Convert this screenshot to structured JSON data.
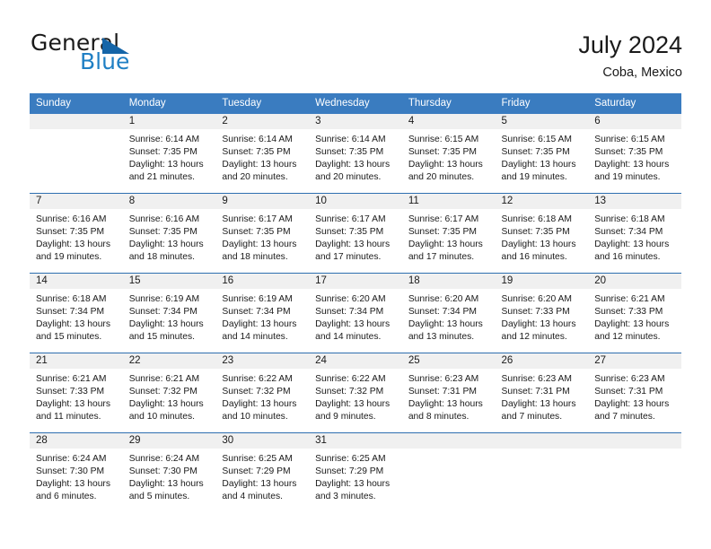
{
  "brand": {
    "word1": "General",
    "word2": "Blue",
    "flag_icon": "triangle-flag-icon"
  },
  "header": {
    "title": "July 2024",
    "subtitle": "Coba, Mexico"
  },
  "colors": {
    "header_blue": "#3a7cc0",
    "row_separator": "#2e6fb0",
    "daynum_band": "#f0f0f0",
    "brand_blue": "#1f7fc4",
    "flag_blue": "#1565a8",
    "text": "#1a1a1a"
  },
  "calendar": {
    "weekday_headers": [
      "Sunday",
      "Monday",
      "Tuesday",
      "Wednesday",
      "Thursday",
      "Friday",
      "Saturday"
    ],
    "weeks": [
      [
        {
          "day": "",
          "lines": []
        },
        {
          "day": "1",
          "lines": [
            "Sunrise: 6:14 AM",
            "Sunset: 7:35 PM",
            "Daylight: 13 hours",
            "and 21 minutes."
          ]
        },
        {
          "day": "2",
          "lines": [
            "Sunrise: 6:14 AM",
            "Sunset: 7:35 PM",
            "Daylight: 13 hours",
            "and 20 minutes."
          ]
        },
        {
          "day": "3",
          "lines": [
            "Sunrise: 6:14 AM",
            "Sunset: 7:35 PM",
            "Daylight: 13 hours",
            "and 20 minutes."
          ]
        },
        {
          "day": "4",
          "lines": [
            "Sunrise: 6:15 AM",
            "Sunset: 7:35 PM",
            "Daylight: 13 hours",
            "and 20 minutes."
          ]
        },
        {
          "day": "5",
          "lines": [
            "Sunrise: 6:15 AM",
            "Sunset: 7:35 PM",
            "Daylight: 13 hours",
            "and 19 minutes."
          ]
        },
        {
          "day": "6",
          "lines": [
            "Sunrise: 6:15 AM",
            "Sunset: 7:35 PM",
            "Daylight: 13 hours",
            "and 19 minutes."
          ]
        }
      ],
      [
        {
          "day": "7",
          "lines": [
            "Sunrise: 6:16 AM",
            "Sunset: 7:35 PM",
            "Daylight: 13 hours",
            "and 19 minutes."
          ]
        },
        {
          "day": "8",
          "lines": [
            "Sunrise: 6:16 AM",
            "Sunset: 7:35 PM",
            "Daylight: 13 hours",
            "and 18 minutes."
          ]
        },
        {
          "day": "9",
          "lines": [
            "Sunrise: 6:17 AM",
            "Sunset: 7:35 PM",
            "Daylight: 13 hours",
            "and 18 minutes."
          ]
        },
        {
          "day": "10",
          "lines": [
            "Sunrise: 6:17 AM",
            "Sunset: 7:35 PM",
            "Daylight: 13 hours",
            "and 17 minutes."
          ]
        },
        {
          "day": "11",
          "lines": [
            "Sunrise: 6:17 AM",
            "Sunset: 7:35 PM",
            "Daylight: 13 hours",
            "and 17 minutes."
          ]
        },
        {
          "day": "12",
          "lines": [
            "Sunrise: 6:18 AM",
            "Sunset: 7:35 PM",
            "Daylight: 13 hours",
            "and 16 minutes."
          ]
        },
        {
          "day": "13",
          "lines": [
            "Sunrise: 6:18 AM",
            "Sunset: 7:34 PM",
            "Daylight: 13 hours",
            "and 16 minutes."
          ]
        }
      ],
      [
        {
          "day": "14",
          "lines": [
            "Sunrise: 6:18 AM",
            "Sunset: 7:34 PM",
            "Daylight: 13 hours",
            "and 15 minutes."
          ]
        },
        {
          "day": "15",
          "lines": [
            "Sunrise: 6:19 AM",
            "Sunset: 7:34 PM",
            "Daylight: 13 hours",
            "and 15 minutes."
          ]
        },
        {
          "day": "16",
          "lines": [
            "Sunrise: 6:19 AM",
            "Sunset: 7:34 PM",
            "Daylight: 13 hours",
            "and 14 minutes."
          ]
        },
        {
          "day": "17",
          "lines": [
            "Sunrise: 6:20 AM",
            "Sunset: 7:34 PM",
            "Daylight: 13 hours",
            "and 14 minutes."
          ]
        },
        {
          "day": "18",
          "lines": [
            "Sunrise: 6:20 AM",
            "Sunset: 7:34 PM",
            "Daylight: 13 hours",
            "and 13 minutes."
          ]
        },
        {
          "day": "19",
          "lines": [
            "Sunrise: 6:20 AM",
            "Sunset: 7:33 PM",
            "Daylight: 13 hours",
            "and 12 minutes."
          ]
        },
        {
          "day": "20",
          "lines": [
            "Sunrise: 6:21 AM",
            "Sunset: 7:33 PM",
            "Daylight: 13 hours",
            "and 12 minutes."
          ]
        }
      ],
      [
        {
          "day": "21",
          "lines": [
            "Sunrise: 6:21 AM",
            "Sunset: 7:33 PM",
            "Daylight: 13 hours",
            "and 11 minutes."
          ]
        },
        {
          "day": "22",
          "lines": [
            "Sunrise: 6:21 AM",
            "Sunset: 7:32 PM",
            "Daylight: 13 hours",
            "and 10 minutes."
          ]
        },
        {
          "day": "23",
          "lines": [
            "Sunrise: 6:22 AM",
            "Sunset: 7:32 PM",
            "Daylight: 13 hours",
            "and 10 minutes."
          ]
        },
        {
          "day": "24",
          "lines": [
            "Sunrise: 6:22 AM",
            "Sunset: 7:32 PM",
            "Daylight: 13 hours",
            "and 9 minutes."
          ]
        },
        {
          "day": "25",
          "lines": [
            "Sunrise: 6:23 AM",
            "Sunset: 7:31 PM",
            "Daylight: 13 hours",
            "and 8 minutes."
          ]
        },
        {
          "day": "26",
          "lines": [
            "Sunrise: 6:23 AM",
            "Sunset: 7:31 PM",
            "Daylight: 13 hours",
            "and 7 minutes."
          ]
        },
        {
          "day": "27",
          "lines": [
            "Sunrise: 6:23 AM",
            "Sunset: 7:31 PM",
            "Daylight: 13 hours",
            "and 7 minutes."
          ]
        }
      ],
      [
        {
          "day": "28",
          "lines": [
            "Sunrise: 6:24 AM",
            "Sunset: 7:30 PM",
            "Daylight: 13 hours",
            "and 6 minutes."
          ]
        },
        {
          "day": "29",
          "lines": [
            "Sunrise: 6:24 AM",
            "Sunset: 7:30 PM",
            "Daylight: 13 hours",
            "and 5 minutes."
          ]
        },
        {
          "day": "30",
          "lines": [
            "Sunrise: 6:25 AM",
            "Sunset: 7:29 PM",
            "Daylight: 13 hours",
            "and 4 minutes."
          ]
        },
        {
          "day": "31",
          "lines": [
            "Sunrise: 6:25 AM",
            "Sunset: 7:29 PM",
            "Daylight: 13 hours",
            "and 3 minutes."
          ]
        },
        {
          "day": "",
          "lines": []
        },
        {
          "day": "",
          "lines": []
        },
        {
          "day": "",
          "lines": []
        }
      ]
    ]
  }
}
